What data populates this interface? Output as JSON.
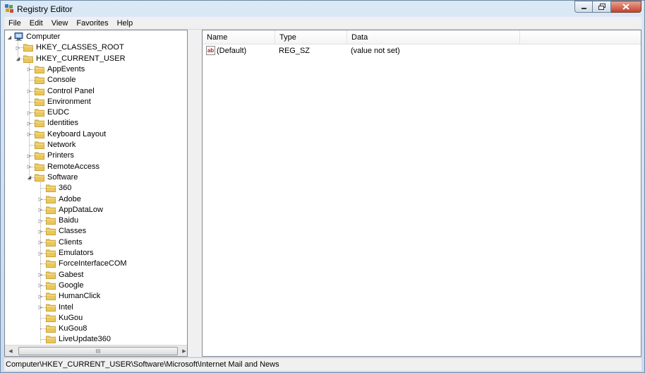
{
  "window": {
    "title": "Registry Editor"
  },
  "menubar": [
    "File",
    "Edit",
    "View",
    "Favorites",
    "Help"
  ],
  "tree": [
    {
      "label": "Computer",
      "level": 0,
      "expander": "open",
      "icon": "computer-icon"
    },
    {
      "label": "HKEY_CLASSES_ROOT",
      "level": 1,
      "expander": "closed"
    },
    {
      "label": "HKEY_CURRENT_USER",
      "level": 1,
      "expander": "open"
    },
    {
      "label": "AppEvents",
      "level": 2,
      "expander": "closed"
    },
    {
      "label": "Console",
      "level": 2,
      "expander": "none"
    },
    {
      "label": "Control Panel",
      "level": 2,
      "expander": "closed"
    },
    {
      "label": "Environment",
      "level": 2,
      "expander": "none"
    },
    {
      "label": "EUDC",
      "level": 2,
      "expander": "closed"
    },
    {
      "label": "Identities",
      "level": 2,
      "expander": "closed"
    },
    {
      "label": "Keyboard Layout",
      "level": 2,
      "expander": "closed"
    },
    {
      "label": "Network",
      "level": 2,
      "expander": "none"
    },
    {
      "label": "Printers",
      "level": 2,
      "expander": "closed"
    },
    {
      "label": "RemoteAccess",
      "level": 2,
      "expander": "closed"
    },
    {
      "label": "Software",
      "level": 2,
      "expander": "open"
    },
    {
      "label": "360",
      "level": 3,
      "expander": "none"
    },
    {
      "label": "Adobe",
      "level": 3,
      "expander": "closed"
    },
    {
      "label": "AppDataLow",
      "level": 3,
      "expander": "closed"
    },
    {
      "label": "Baidu",
      "level": 3,
      "expander": "closed"
    },
    {
      "label": "Classes",
      "level": 3,
      "expander": "closed"
    },
    {
      "label": "Clients",
      "level": 3,
      "expander": "closed"
    },
    {
      "label": "Emulators",
      "level": 3,
      "expander": "closed"
    },
    {
      "label": "ForceInterfaceCOM",
      "level": 3,
      "expander": "none"
    },
    {
      "label": "Gabest",
      "level": 3,
      "expander": "closed"
    },
    {
      "label": "Google",
      "level": 3,
      "expander": "closed"
    },
    {
      "label": "HumanClick",
      "level": 3,
      "expander": "closed"
    },
    {
      "label": "Intel",
      "level": 3,
      "expander": "closed"
    },
    {
      "label": "KuGou",
      "level": 3,
      "expander": "none"
    },
    {
      "label": "KuGou8",
      "level": 3,
      "expander": "none"
    },
    {
      "label": "LiveUpdate360",
      "level": 3,
      "expander": "none"
    }
  ],
  "list": {
    "columns": [
      "Name",
      "Type",
      "Data"
    ],
    "rows": [
      {
        "name": "(Default)",
        "type": "REG_SZ",
        "data": "(value not set)",
        "icon": "ab"
      }
    ]
  },
  "hscroll": {
    "grip": "III"
  },
  "statusbar": {
    "path": "Computer\\HKEY_CURRENT_USER\\Software\\Microsoft\\Internet Mail and News"
  },
  "colors": {
    "folder": "#e9c75a",
    "folder_dark": "#c9a23a",
    "close": "#c2442c"
  }
}
